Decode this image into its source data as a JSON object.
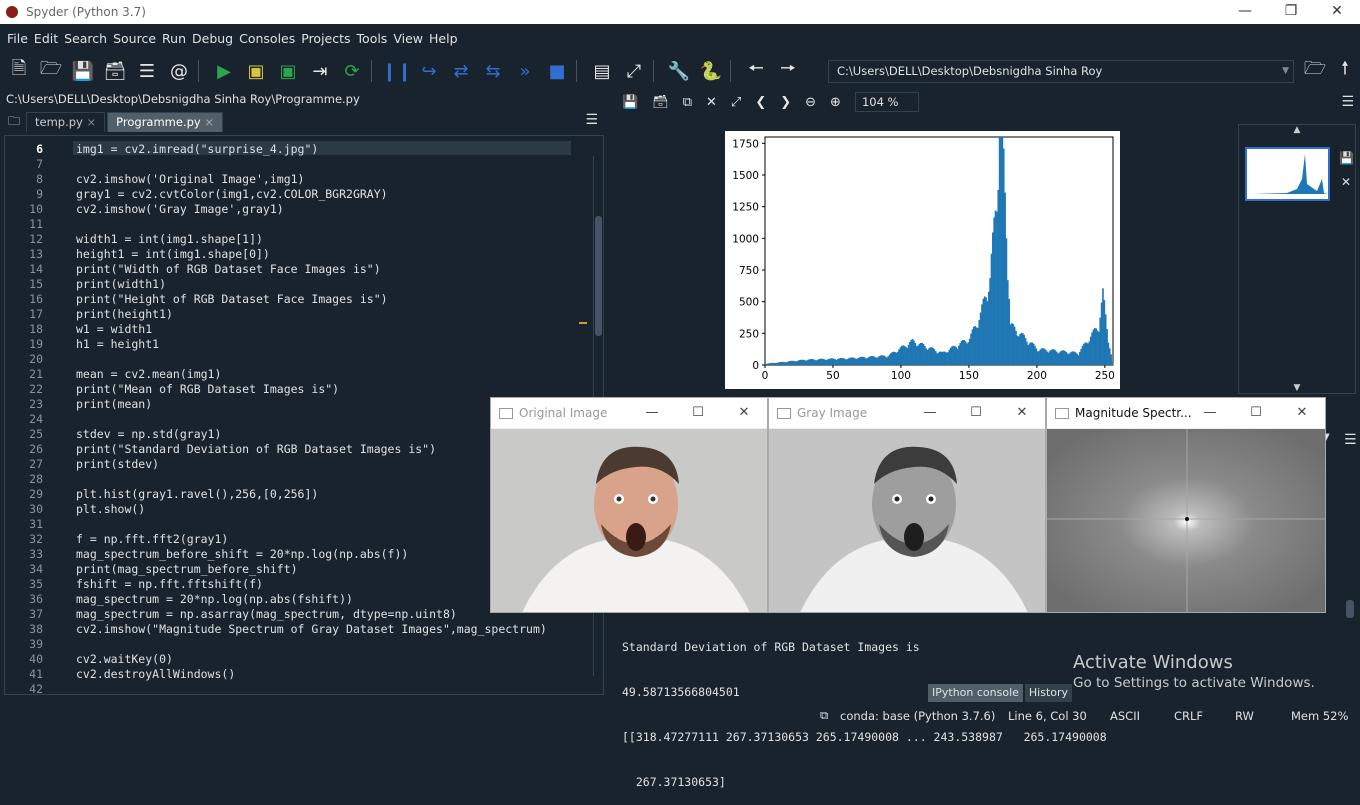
{
  "window": {
    "title": "Spyder (Python 3.7)"
  },
  "menu": [
    "File",
    "Edit",
    "Search",
    "Source",
    "Run",
    "Debug",
    "Consoles",
    "Projects",
    "Tools",
    "View",
    "Help"
  ],
  "toolbar": {
    "path": "C:\\Users\\DELL\\Desktop\\Debsnigdha Sinha Roy"
  },
  "editor": {
    "filepath": "C:\\Users\\DELL\\Desktop\\Debsnigdha Sinha Roy\\Programme.py",
    "tabs": [
      {
        "label": "temp.py"
      },
      {
        "label": "Programme.py"
      }
    ],
    "lines": [
      {
        "n": "6",
        "t": "img1 = cv2.imread(\"surprise_4.jpg\")"
      },
      {
        "n": "7",
        "t": ""
      },
      {
        "n": "8",
        "t": "cv2.imshow('Original Image',img1)"
      },
      {
        "n": "9",
        "t": "gray1 = cv2.cvtColor(img1,cv2.COLOR_BGR2GRAY)"
      },
      {
        "n": "10",
        "t": "cv2.imshow('Gray Image',gray1)"
      },
      {
        "n": "11",
        "t": ""
      },
      {
        "n": "12",
        "t": "width1 = int(img1.shape[1])"
      },
      {
        "n": "13",
        "t": "height1 = int(img1.shape[0])"
      },
      {
        "n": "14",
        "t": "print(\"Width of RGB Dataset Face Images is\")"
      },
      {
        "n": "15",
        "t": "print(width1)"
      },
      {
        "n": "16",
        "t": "print(\"Height of RGB Dataset Face Images is\")"
      },
      {
        "n": "17",
        "t": "print(height1)"
      },
      {
        "n": "18",
        "t": "w1 = width1"
      },
      {
        "n": "19",
        "t": "h1 = height1"
      },
      {
        "n": "20",
        "t": ""
      },
      {
        "n": "21",
        "t": "mean = cv2.mean(img1)"
      },
      {
        "n": "22",
        "t": "print(\"Mean of RGB Dataset Images is\")"
      },
      {
        "n": "23",
        "t": "print(mean)"
      },
      {
        "n": "24",
        "t": ""
      },
      {
        "n": "25",
        "t": "stdev = np.std(gray1)"
      },
      {
        "n": "26",
        "t": "print(\"Standard Deviation of RGB Dataset Images is\")"
      },
      {
        "n": "27",
        "t": "print(stdev)"
      },
      {
        "n": "28",
        "t": ""
      },
      {
        "n": "29",
        "t": "plt.hist(gray1.ravel(),256,[0,256])"
      },
      {
        "n": "30",
        "t": "plt.show()"
      },
      {
        "n": "31",
        "t": ""
      },
      {
        "n": "32",
        "t": "f = np.fft.fft2(gray1)"
      },
      {
        "n": "33",
        "t": "mag_spectrum_before_shift = 20*np.log(np.abs(f))"
      },
      {
        "n": "34",
        "t": "print(mag_spectrum_before_shift)"
      },
      {
        "n": "35",
        "t": "fshift = np.fft.fftshift(f)"
      },
      {
        "n": "36",
        "t": "mag_spectrum = 20*np.log(np.abs(fshift))"
      },
      {
        "n": "37",
        "t": "mag_spectrum = np.asarray(mag_spectrum, dtype=np.uint8)"
      },
      {
        "n": "38",
        "t": "cv2.imshow(\"Magnitude Spectrum of Gray Dataset Images\",mag_spectrum)"
      },
      {
        "n": "39",
        "t": ""
      },
      {
        "n": "40",
        "t": "cv2.waitKey(0)"
      },
      {
        "n": "41",
        "t": "cv2.destroyAllWindows()"
      },
      {
        "n": "42",
        "t": ""
      }
    ]
  },
  "plots": {
    "zoom": "104 %"
  },
  "chart_data": {
    "type": "bar",
    "title": "",
    "xlabel": "",
    "ylabel": "",
    "xlim": [
      0,
      256
    ],
    "ylim": [
      0,
      1800
    ],
    "xticks": [
      "0",
      "50",
      "100",
      "150",
      "200",
      "250"
    ],
    "yticks": [
      "0",
      "250",
      "500",
      "750",
      "1000",
      "1250",
      "1500",
      "1750"
    ],
    "bins": 256,
    "peaks": [
      {
        "x": 0,
        "y": 10
      },
      {
        "x": 30,
        "y": 40
      },
      {
        "x": 60,
        "y": 50
      },
      {
        "x": 90,
        "y": 70
      },
      {
        "x": 108,
        "y": 180
      },
      {
        "x": 130,
        "y": 90
      },
      {
        "x": 150,
        "y": 200
      },
      {
        "x": 158,
        "y": 380
      },
      {
        "x": 165,
        "y": 650
      },
      {
        "x": 170,
        "y": 1300
      },
      {
        "x": 172,
        "y": 1790
      },
      {
        "x": 175,
        "y": 1500
      },
      {
        "x": 180,
        "y": 300
      },
      {
        "x": 200,
        "y": 120
      },
      {
        "x": 230,
        "y": 90
      },
      {
        "x": 245,
        "y": 300
      },
      {
        "x": 248,
        "y": 530
      },
      {
        "x": 252,
        "y": 200
      },
      {
        "x": 255,
        "y": 20
      }
    ],
    "series": [
      {
        "color": "#1f77b4"
      }
    ]
  },
  "console": {
    "lines": [
      "Standard Deviation of RGB Dataset Images is",
      "49.58713566804501",
      "[[318.47277111 267.37130653 265.17490008 ... 243.538987   265.17490008",
      "  267.37130653]"
    ],
    "tabs": [
      "IPython console",
      "History"
    ]
  },
  "watermark": {
    "line1": "Activate Windows",
    "line2": "Go to Settings to activate Windows."
  },
  "status": {
    "env": "conda: base (Python 3.7.6)",
    "position": "Line 6, Col 30",
    "encoding": "ASCII",
    "eol": "CRLF",
    "rw": "RW",
    "mem": "Mem 52%"
  },
  "cv_windows": [
    {
      "title": "Original Image"
    },
    {
      "title": "Gray Image"
    },
    {
      "title": "Magnitude Spectr..."
    }
  ]
}
